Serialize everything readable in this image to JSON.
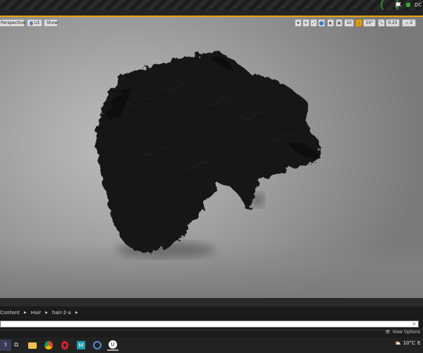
{
  "titlebar": {
    "text": "DC"
  },
  "viewport": {
    "perspective_label": "Perspective",
    "lit_label": "Lit",
    "show_label": "Show",
    "grid_snap": "10",
    "rotation_snap": "10°",
    "scale_snap": "0.25",
    "camera_speed": "2"
  },
  "content_browser": {
    "breadcrumbs": [
      "Content",
      "Hair",
      "hair-2-a"
    ],
    "view_options_label": "View Options"
  },
  "taskbar": {
    "weather_temp": "10°C",
    "weather_extra": "E"
  }
}
